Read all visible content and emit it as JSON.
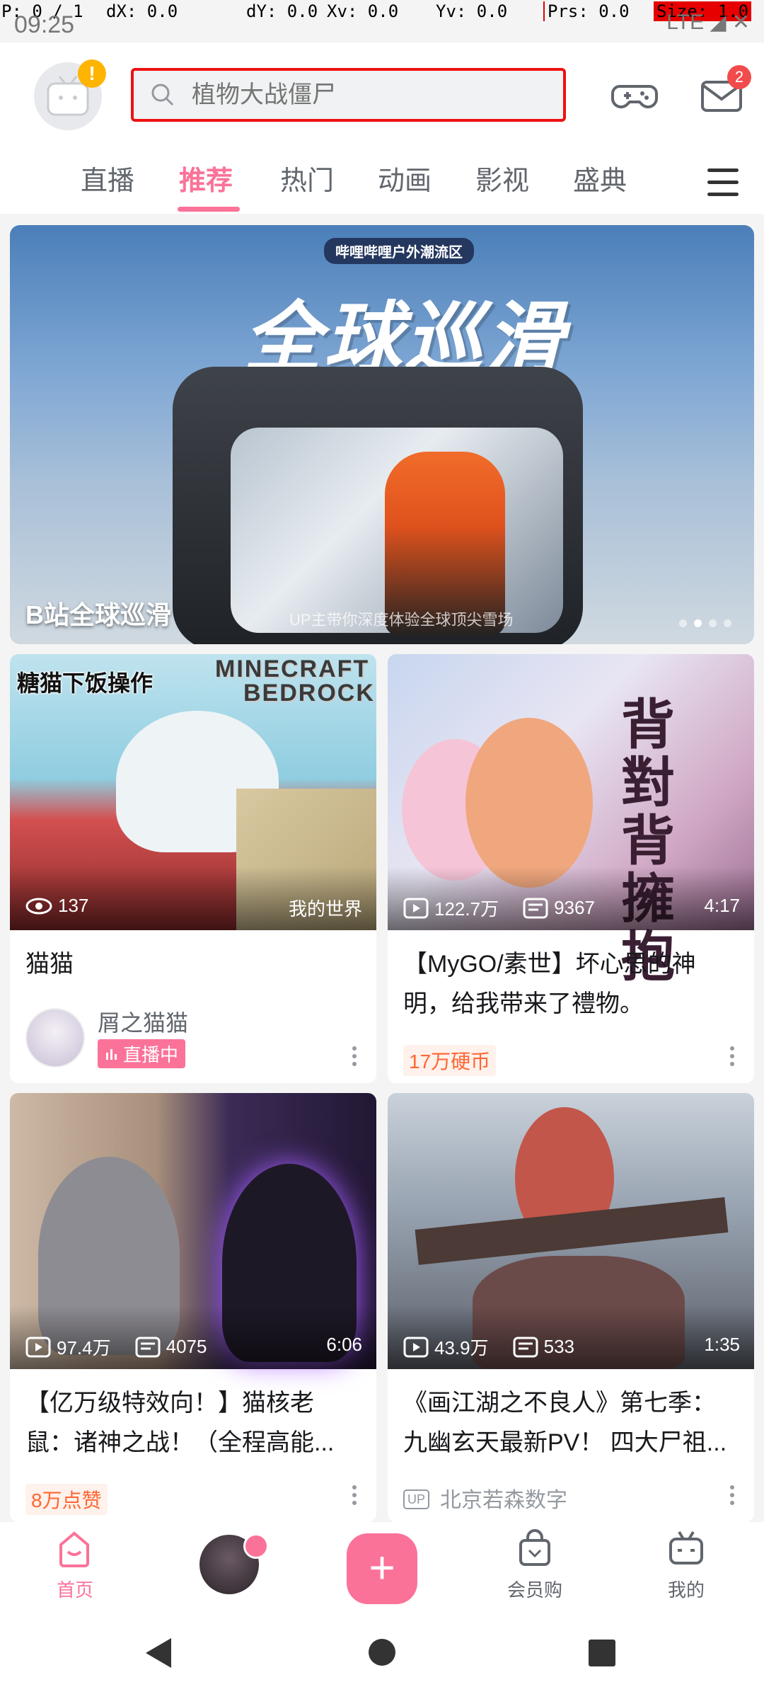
{
  "overlay": {
    "p": "P: 0 / 1",
    "dx": "dX: 0.0",
    "dy": "dY: 0.0",
    "xv": "Xv: 0.0",
    "yv": "Yv: 0.0",
    "prs": "Prs: 0.0",
    "size": "Size: 1.0"
  },
  "status": {
    "time": "09:25",
    "signal": "LTE"
  },
  "header": {
    "avatar_badge": "!",
    "search_placeholder": "植物大战僵尸",
    "message_count": "2"
  },
  "tabs": [
    {
      "label": "直播"
    },
    {
      "label": "推荐"
    },
    {
      "label": "热门"
    },
    {
      "label": "动画"
    },
    {
      "label": "影视"
    },
    {
      "label": "盛典"
    }
  ],
  "banner": {
    "brand": "哔哩哔哩户外潮流区",
    "big_title": "全球巡滑",
    "subtitle": "UP主带你深度体验全球顶尖雪场",
    "title": "B站全球巡滑"
  },
  "cards": [
    {
      "overlay": "糖猫下饭操作",
      "logo_line1": "MINECRAFT",
      "logo_line2": "BEDROCK",
      "views": "137",
      "category": "我的世界",
      "title": "猫猫",
      "author": "屑之猫猫",
      "live": "直播中"
    },
    {
      "views": "122.7万",
      "danmaku": "9367",
      "duration": "4:17",
      "title": "【MyGO/素世】坏心思的神明，给我带来了禮物。",
      "tag": "17万硬币",
      "cover_text": "背對背擁抱"
    },
    {
      "views": "97.4万",
      "danmaku": "4075",
      "duration": "6:06",
      "title": "【亿万级特效向！】猫核老鼠：诸神之战！（全程高能...",
      "tag": "8万点赞"
    },
    {
      "views": "43.9万",
      "danmaku": "533",
      "duration": "1:35",
      "title": "《画江湖之不良人》第七季：九幽玄天最新PV！ 四大尸祖...",
      "author": "北京若森数字",
      "up_badge": "UP"
    }
  ],
  "bottom_nav": {
    "home": "首页",
    "vip": "会员购",
    "mine": "我的"
  },
  "colors": {
    "accent": "#fb7299",
    "search_outline": "#ee1111"
  }
}
